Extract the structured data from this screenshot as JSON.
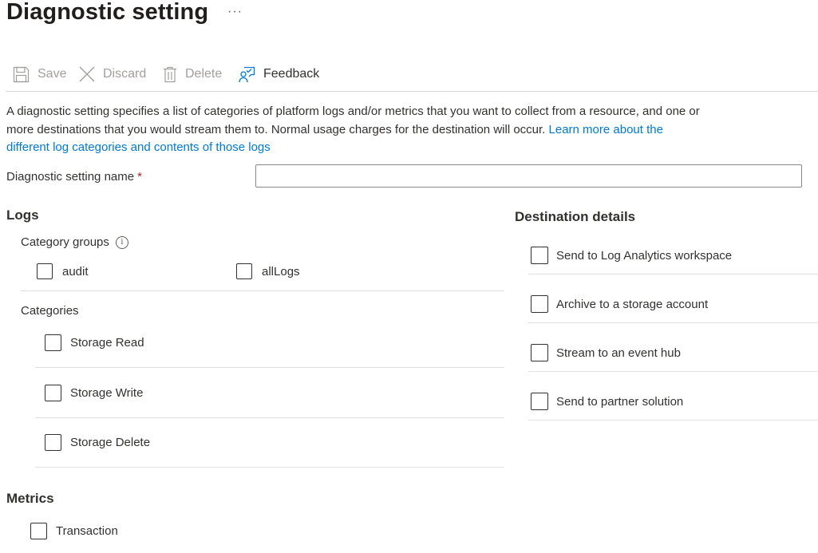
{
  "page": {
    "title": "Diagnostic setting",
    "more_glyph": "···"
  },
  "toolbar": {
    "save_label": "Save",
    "discard_label": "Discard",
    "delete_label": "Delete",
    "feedback_label": "Feedback"
  },
  "description": {
    "text": "A diagnostic setting specifies a list of categories of platform logs and/or metrics that you want to collect from a resource, and one or more destinations that you would stream them to. Normal usage charges for the destination will occur.",
    "link_text": "Learn more about the different log categories and contents of those logs"
  },
  "name_field": {
    "label": "Diagnostic setting name",
    "required_marker": "*",
    "value": "",
    "placeholder": ""
  },
  "logs": {
    "heading": "Logs",
    "category_groups_label": "Category groups",
    "info_glyph": "i",
    "category_groups": [
      {
        "label": "audit",
        "checked": false
      },
      {
        "label": "allLogs",
        "checked": false
      }
    ],
    "categories_label": "Categories",
    "categories": [
      {
        "label": "Storage Read",
        "checked": false
      },
      {
        "label": "Storage Write",
        "checked": false
      },
      {
        "label": "Storage Delete",
        "checked": false
      }
    ]
  },
  "metrics": {
    "heading": "Metrics",
    "items": [
      {
        "label": "Transaction",
        "checked": false
      }
    ]
  },
  "destinations": {
    "heading": "Destination details",
    "items": [
      {
        "label": "Send to Log Analytics workspace",
        "checked": false
      },
      {
        "label": "Archive to a storage account",
        "checked": false
      },
      {
        "label": "Stream to an event hub",
        "checked": false
      },
      {
        "label": "Send to partner solution",
        "checked": false
      }
    ]
  },
  "colors": {
    "link": "#0078d4",
    "required": "#a4262c",
    "disabled_text": "#a19f9d",
    "text": "#323130"
  }
}
